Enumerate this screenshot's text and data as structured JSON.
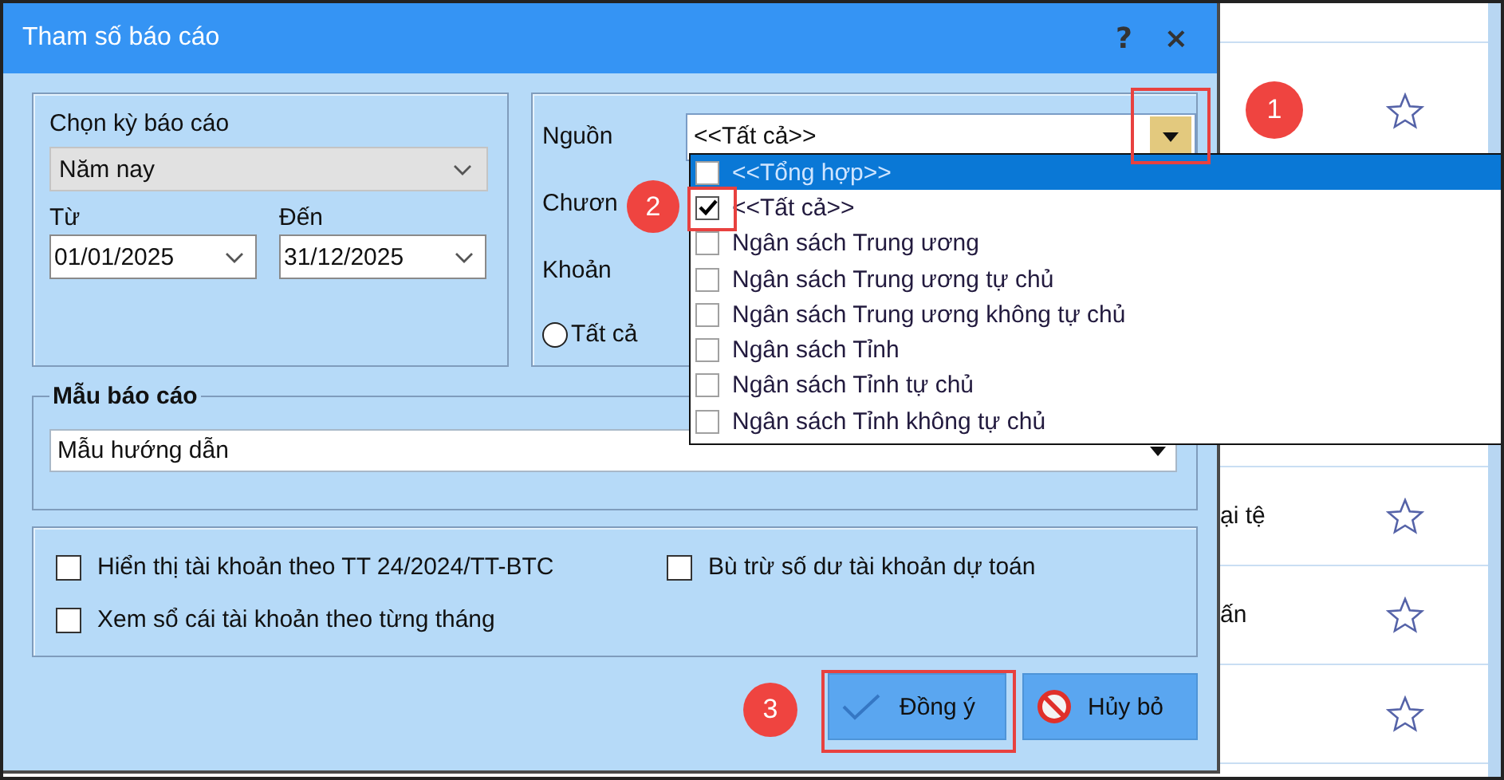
{
  "dialog": {
    "title": "Tham số báo cáo",
    "help": "?",
    "close": "×",
    "period": {
      "label": "Chọn kỳ báo cáo",
      "value": "Năm nay",
      "from_label": "Từ",
      "from": "01/01/2025",
      "to_label": "Đến",
      "to": "31/12/2025"
    },
    "filters": {
      "source_label": "Nguồn",
      "source_value": "<<Tất cả>>",
      "chapter_label": "Chươn",
      "item_label": "Khoản",
      "radio": {
        "label": "Tất cả",
        "selected": false
      }
    },
    "template": {
      "legend": "Mẫu báo cáo",
      "value": "Mẫu hướng dẫn"
    },
    "options": [
      {
        "label": "Hiển thị tài khoản theo TT 24/2024/TT-BTC",
        "checked": false
      },
      {
        "label": "Bù trừ số dư tài khoản dự toán",
        "checked": false
      },
      {
        "label": "Xem sổ cái tài khoản theo từng tháng",
        "checked": false
      }
    ],
    "buttons": [
      {
        "label": "Đồng ý",
        "kind": "ok"
      },
      {
        "label": "Hủy bỏ",
        "kind": "cancel"
      }
    ]
  },
  "source_list": {
    "items": [
      {
        "label": "<<Tổng hợp>>",
        "checked": false,
        "selected": true
      },
      {
        "label": "<<Tất cả>>",
        "checked": true,
        "selected": false
      },
      {
        "label": "Ngân sách Trung ương",
        "checked": false,
        "selected": false
      },
      {
        "label": "Ngân sách Trung ương tự chủ",
        "checked": false,
        "selected": false
      },
      {
        "label": "Ngân sách Trung ương không tự chủ",
        "checked": false,
        "selected": false
      },
      {
        "label": "Ngân sách Tỉnh",
        "checked": false,
        "selected": false
      },
      {
        "label": "Ngân sách Tỉnh tự chủ",
        "checked": false,
        "selected": false
      },
      {
        "label": "Ngân sách Tỉnh không tự chủ",
        "checked": false,
        "selected": false
      }
    ]
  },
  "background_list": {
    "rows": [
      {
        "kind": "star"
      },
      {
        "kind": "hidden"
      },
      {
        "kind": "star",
        "text": "ại tệ"
      },
      {
        "kind": "star",
        "text": "ấn"
      },
      {
        "kind": "star"
      }
    ]
  },
  "callouts": [
    {
      "number": "1"
    },
    {
      "number": "2"
    },
    {
      "number": "3"
    }
  ]
}
